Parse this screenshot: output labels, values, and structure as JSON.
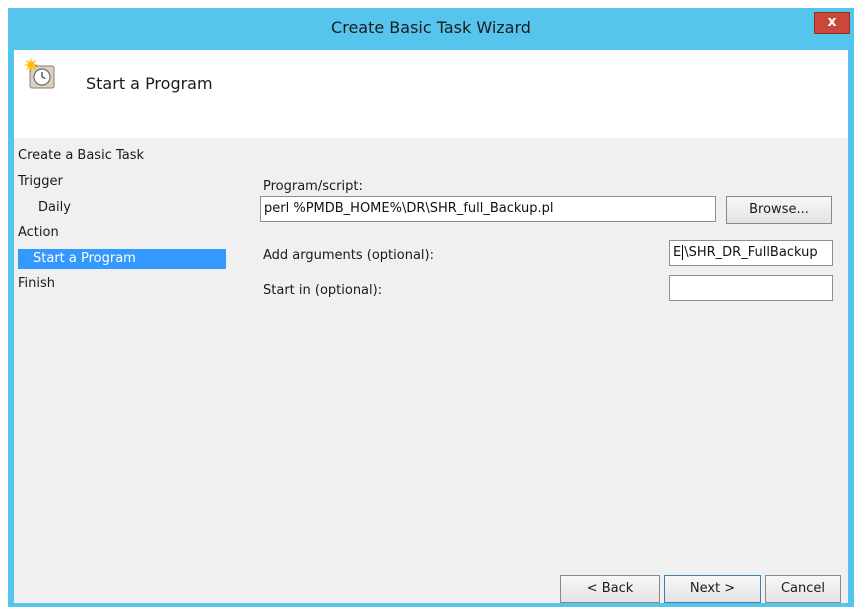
{
  "window": {
    "title": "Create Basic Task Wizard",
    "close_label": "x"
  },
  "header": {
    "title": "Start a Program",
    "icon": "task-scheduler-clock-icon"
  },
  "nav": {
    "items": [
      {
        "label": "Create a Basic Task",
        "level": 0,
        "selected": false
      },
      {
        "label": "Trigger",
        "level": 0,
        "selected": false
      },
      {
        "label": "Daily",
        "level": 1,
        "selected": false
      },
      {
        "label": "Action",
        "level": 0,
        "selected": false
      },
      {
        "label": "Start a Program",
        "level": 1,
        "selected": true
      },
      {
        "label": "Finish",
        "level": 0,
        "selected": false
      }
    ]
  },
  "form": {
    "program_label": "Program/script:",
    "program_value": "perl %PMDB_HOME%\\DR\\SHR_full_Backup.pl",
    "browse_label": "Browse...",
    "args_label": "Add arguments (optional):",
    "args_value_start": "E",
    "args_value_rest": "\\SHR_DR_FullBackup",
    "start_in_label": "Start in (optional):",
    "start_in_value": ""
  },
  "buttons": {
    "back": "< Back",
    "next": "Next >",
    "cancel": "Cancel"
  },
  "colors": {
    "titlebar": "#56c5ee",
    "selection": "#3399ff",
    "close": "#c9483a"
  }
}
